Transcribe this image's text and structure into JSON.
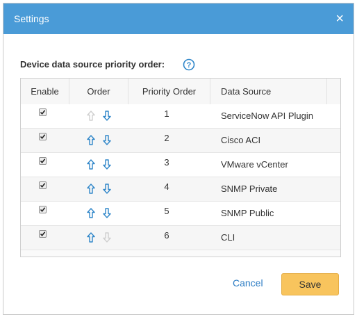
{
  "dialog": {
    "title": "Settings",
    "close_glyph": "×",
    "section_label": "Device data source priority order:",
    "help_icon": "help-circle-icon"
  },
  "table": {
    "columns": [
      "Enable",
      "Order",
      "Priority Order",
      "Data Source"
    ],
    "rows": [
      {
        "enabled": true,
        "up_enabled": false,
        "down_enabled": true,
        "priority": "1",
        "source": "ServiceNow API Plugin"
      },
      {
        "enabled": true,
        "up_enabled": true,
        "down_enabled": true,
        "priority": "2",
        "source": "Cisco ACI"
      },
      {
        "enabled": true,
        "up_enabled": true,
        "down_enabled": true,
        "priority": "3",
        "source": "VMware vCenter"
      },
      {
        "enabled": true,
        "up_enabled": true,
        "down_enabled": true,
        "priority": "4",
        "source": "SNMP Private"
      },
      {
        "enabled": true,
        "up_enabled": true,
        "down_enabled": true,
        "priority": "5",
        "source": "SNMP Public"
      },
      {
        "enabled": true,
        "up_enabled": true,
        "down_enabled": false,
        "priority": "6",
        "source": "CLI"
      }
    ]
  },
  "footer": {
    "cancel_label": "Cancel",
    "save_label": "Save"
  },
  "colors": {
    "titlebar": "#4a9bd7",
    "arrow_active": "#2f86c9",
    "arrow_disabled": "#cfcfcf",
    "save_button": "#f8c45d",
    "cancel_link": "#2d7dc4"
  }
}
